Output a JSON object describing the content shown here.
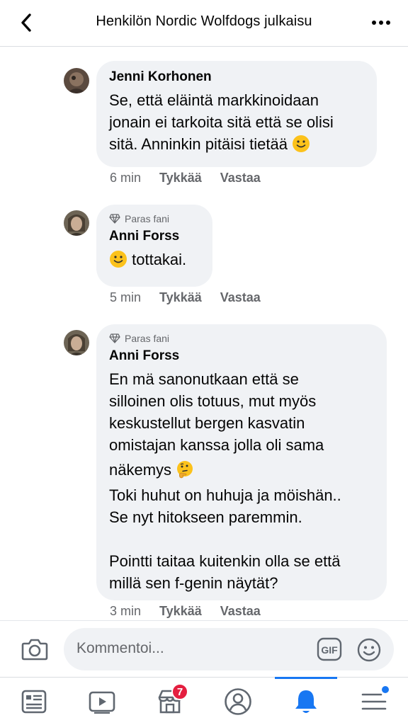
{
  "header": {
    "title": "Henkilön Nordic Wolfdogs julkaisu",
    "back_icon": "chevron-left-icon",
    "more_icon": "more-horizontal-icon"
  },
  "comments": [
    {
      "author": "Jenni Korhonen",
      "badge": "",
      "text_lines": [
        "Se, että eläintä markkinoidaan",
        "jonain ei tarkoita sitä että se olisi",
        "sitä. Anninkin pitäisi tietää"
      ],
      "emoji": "slightly-smiling-face",
      "time": "6 min",
      "like": "Tykkää",
      "reply": "Vastaa"
    },
    {
      "author": "Anni Forss",
      "badge": "Paras fani",
      "text_prefix_emoji": "slightly-smiling-face",
      "text": "tottakai.",
      "time": "5 min",
      "like": "Tykkää",
      "reply": "Vastaa"
    },
    {
      "author": "Anni Forss",
      "badge": "Paras fani",
      "text_part1": "En mä sanonutkaan että se\nsilloinen olis totuus, mut myös\nkeskustellut bergen kasvatin\nomistajan kanssa jolla oli sama",
      "text_part2": "näkemys",
      "text_part2_emoji": "thinking-face",
      "text_part3": "Toki huhut on huhuja ja möishän..\nSe nyt hitokseen paremmin.\n\nPointti taitaa kuitenkin olla se että\nmillä sen f-genin näytät?",
      "time": "3 min",
      "like": "Tykkää",
      "reply": "Vastaa"
    }
  ],
  "composer": {
    "placeholder": "Kommentoi...",
    "camera_icon": "camera-icon",
    "gif_label": "GIF",
    "emoji_icon": "smiley-icon"
  },
  "tabbar": {
    "items": [
      {
        "name": "news-feed",
        "icon": "news-feed-icon"
      },
      {
        "name": "watch",
        "icon": "video-play-icon"
      },
      {
        "name": "marketplace",
        "icon": "store-icon",
        "badge": "7"
      },
      {
        "name": "profile",
        "icon": "profile-icon"
      },
      {
        "name": "notifications",
        "icon": "bell-icon",
        "active": true
      },
      {
        "name": "menu",
        "icon": "hamburger-menu-icon",
        "dot": true
      }
    ]
  },
  "colors": {
    "accent": "#1877f2",
    "bubble": "#f0f2f5",
    "secondary_text": "#65676b",
    "badge_red": "#e41e3f"
  }
}
